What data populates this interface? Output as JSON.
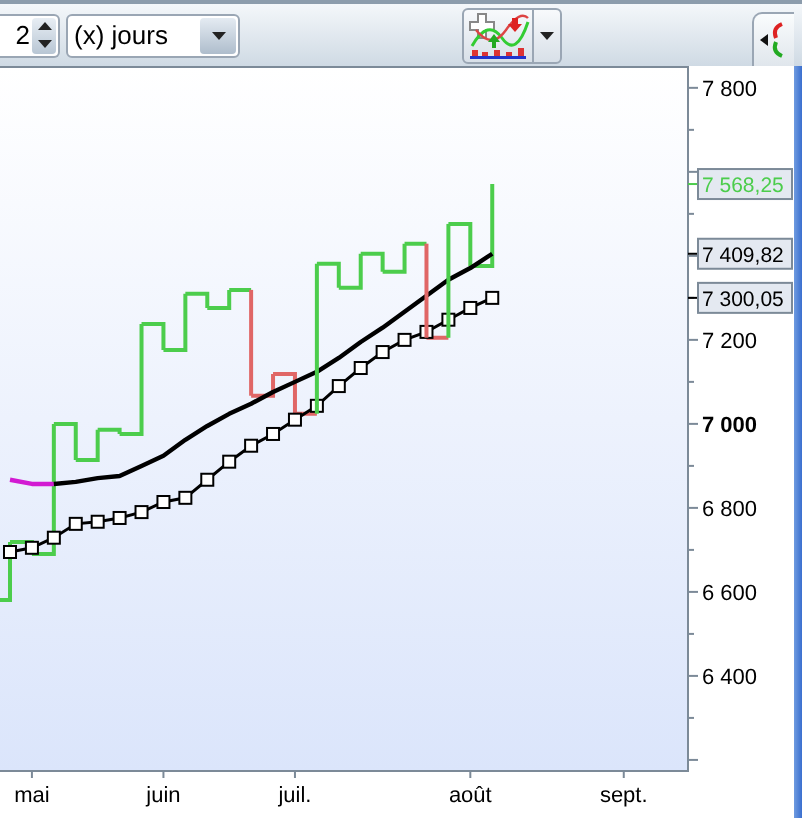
{
  "toolbar": {
    "period_count": {
      "value": "2"
    },
    "period_unit": {
      "value": "(x) jours"
    }
  },
  "chart": {
    "chart_data": {
      "type": "line",
      "categories": [
        null,
        null,
        "mai",
        null,
        null,
        null,
        null,
        null,
        "juin",
        null,
        null,
        null,
        null,
        null,
        "juil.",
        null,
        null,
        null,
        null,
        null,
        null,
        null,
        "août",
        null,
        null,
        null,
        null,
        null,
        null,
        "sept.",
        null,
        null
      ],
      "series": [
        {
          "type": "step",
          "color": "#4ccd4c",
          "values": [
            6581,
            6719,
            6690,
            7000,
            6914,
            6986,
            6976,
            7238,
            7176,
            7310,
            7276,
            7319,
            7319,
            null,
            null,
            7381,
            7324,
            7405,
            7362,
            7429,
            7429,
            null,
            null,
            null,
            null,
            null,
            null,
            null,
            null,
            null,
            null,
            null
          ]
        },
        {
          "type": "step",
          "color": "#e06666",
          "values": [
            null,
            null,
            null,
            null,
            null,
            null,
            null,
            null,
            null,
            null,
            null,
            null,
            7067,
            7119,
            7024,
            7024,
            null,
            null,
            null,
            null,
            7205,
            7205,
            null,
            null,
            null,
            null,
            null,
            null,
            null,
            null,
            null,
            null
          ]
        },
        {
          "type": "step",
          "color": "#4ccd4c",
          "values": [
            null,
            null,
            null,
            null,
            null,
            null,
            null,
            null,
            null,
            null,
            null,
            null,
            null,
            null,
            null,
            null,
            null,
            null,
            null,
            null,
            null,
            7476,
            7376,
            7571,
            null,
            null,
            null,
            null,
            null,
            null,
            null,
            null
          ]
        },
        {
          "type": "line",
          "color": "#d21ad2",
          "values": [
            null,
            6867,
            6857,
            6857,
            null,
            null,
            null,
            null,
            null,
            null,
            null,
            null,
            null,
            null,
            null,
            null,
            null,
            null,
            null,
            null,
            null,
            null,
            null,
            null,
            null,
            null,
            null,
            null,
            null,
            null,
            null,
            null
          ]
        },
        {
          "type": "line",
          "color": "#000000",
          "values": [
            null,
            null,
            null,
            6857,
            6862,
            6871,
            6876,
            6900,
            6924,
            6962,
            6995,
            7024,
            7048,
            7076,
            7100,
            7124,
            7157,
            7195,
            7229,
            7267,
            7305,
            7343,
            7371,
            7405,
            null,
            null,
            null,
            null,
            null,
            null,
            null,
            null
          ]
        },
        {
          "type": "line",
          "marker": "square",
          "color": "#000000",
          "values": [
            null,
            6695,
            6705,
            6729,
            6762,
            6767,
            6776,
            6790,
            6814,
            6824,
            6867,
            6910,
            6948,
            6976,
            7010,
            7043,
            7090,
            7133,
            7171,
            7200,
            7219,
            7248,
            7276,
            7300,
            null,
            null,
            null,
            null,
            null,
            null,
            null,
            null
          ]
        }
      ],
      "ylim": [
        6176,
        7852
      ],
      "yticks": [
        {
          "value": 7800,
          "label": "7 800"
        },
        {
          "value": 7200,
          "label": "7 200"
        },
        {
          "value": 7000,
          "label": "7 000"
        },
        {
          "value": 6800,
          "label": "6 800"
        },
        {
          "value": 6600,
          "label": "6 600"
        },
        {
          "value": 6400,
          "label": "6 400"
        }
      ],
      "annotations": [
        "7 568,25",
        "7 409,82",
        "7 300,05"
      ]
    }
  }
}
